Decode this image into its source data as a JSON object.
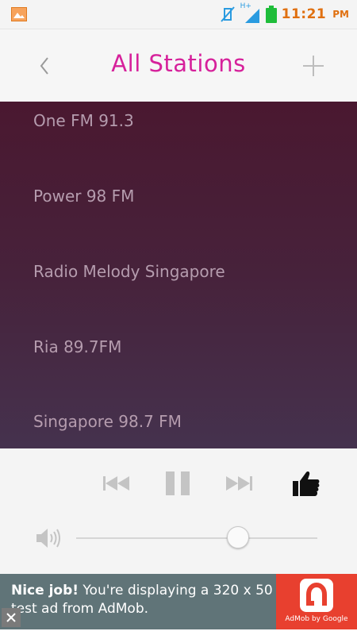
{
  "status_bar": {
    "time": "11:21",
    "ampm": "PM",
    "network_label": "H+"
  },
  "header": {
    "title": "All Stations"
  },
  "stations": [
    "One FM 91.3",
    "Power 98 FM",
    "Radio Melody Singapore",
    "Ria 89.7FM",
    "Singapore 98.7 FM"
  ],
  "player": {
    "volume_level": 0.67
  },
  "ad": {
    "headline": "Nice job!",
    "body": "You're displaying a 320 x 50 test ad from AdMob.",
    "brand": "AdMob by Google"
  },
  "colors": {
    "accent": "#d6219b",
    "clock": "#e07010",
    "battery": "#1fbd3a",
    "signal": "#2a9be0",
    "ad_bg": "#607478",
    "ad_logo_bg": "#e8402f"
  }
}
